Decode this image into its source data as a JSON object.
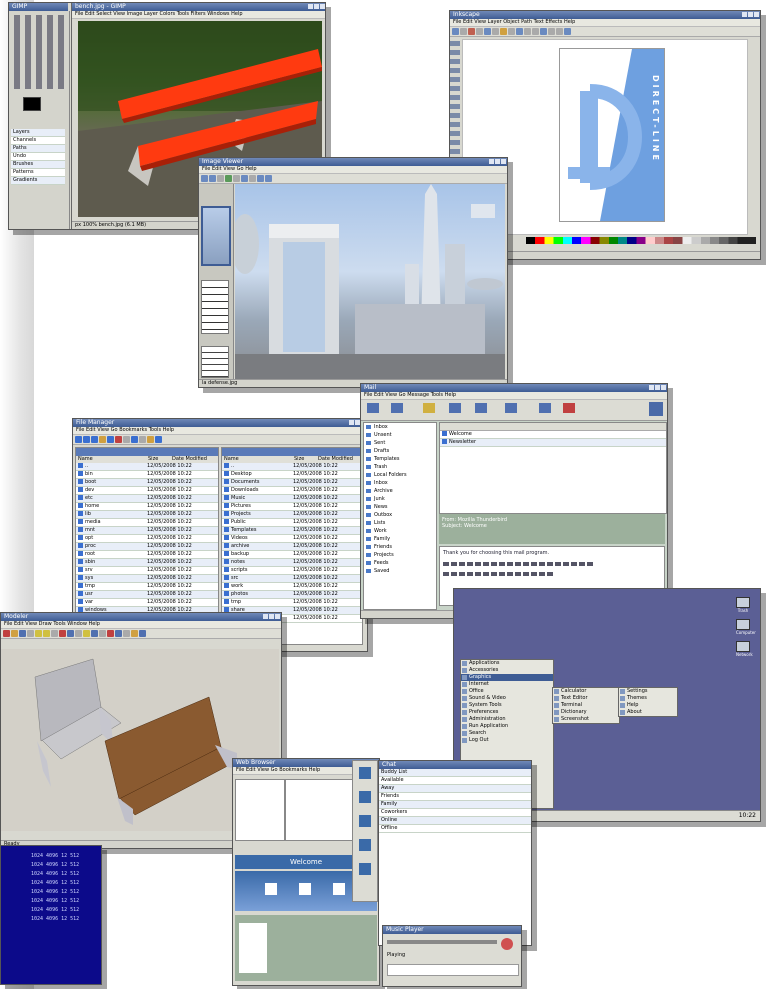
{
  "gimp": {
    "toolbox_title": "GIMP",
    "image_title": "bench.jpg - GIMP",
    "menu": "File  Edit  Select  View  Image  Layer  Colors  Tools  Filters  Windows  Help",
    "layer_panel": [
      "Layers",
      "Channels",
      "Paths",
      "Undo",
      "Brushes",
      "Patterns",
      "Gradients"
    ],
    "status": "px  100%  bench.jpg (6.1 MB)"
  },
  "inkscape": {
    "title": "Inkscape",
    "menu": "File  Edit  View  Layer  Object  Path  Text  Effects  Help",
    "logo_text": "DIRECT-LINE",
    "status": "Drawing"
  },
  "viewer": {
    "title": "Image Viewer",
    "menu": "File  Edit  View  Go  Help",
    "caption": "la defense.jpg"
  },
  "filemanager": {
    "title": "File Manager",
    "menu": "File  Edit  View  Go  Bookmarks  Tools  Help",
    "columns": [
      "Name",
      "Size",
      "Date Modified"
    ],
    "left_files": [
      "..",
      "bin",
      "boot",
      "dev",
      "etc",
      "home",
      "lib",
      "media",
      "mnt",
      "opt",
      "proc",
      "root",
      "sbin",
      "srv",
      "sys",
      "tmp",
      "usr",
      "var",
      "windows",
      "file.txt"
    ],
    "right_files": [
      "..",
      "Desktop",
      "Documents",
      "Downloads",
      "Music",
      "Pictures",
      "Projects",
      "Public",
      "Templates",
      "Videos",
      "archive",
      "backup",
      "notes",
      "scripts",
      "src",
      "work",
      "photos",
      "tmp",
      "share",
      "readme"
    ],
    "date_value": "12/05/2008 10:22"
  },
  "mail": {
    "title": "Mail",
    "menu": "File  Edit  View  Go  Message  Tools  Help",
    "toolbar": [
      "Get Mail",
      "Write",
      "Address Book",
      "Reply",
      "Reply All",
      "Forward",
      "Delete",
      "Print"
    ],
    "folders": [
      "Inbox",
      "Unsent",
      "Sent",
      "Drafts",
      "Templates",
      "Trash",
      "Local Folders",
      "Inbox",
      "Archive",
      "Junk",
      "News",
      "Outbox",
      "Lists",
      "Work",
      "Family",
      "Friends",
      "Projects",
      "Feeds",
      "Saved"
    ],
    "messages": [
      "Welcome",
      "Newsletter"
    ],
    "from": "From: Mozilla Thunderbird",
    "subject": "Subject: Welcome",
    "body": "Thank you for choosing this mail program."
  },
  "cad": {
    "title": "Modeler",
    "menu": "File  Edit  View  Draw  Tools  Window  Help",
    "status": "Ready"
  },
  "desktop": {
    "icons": [
      "Trash",
      "Computer",
      "Network"
    ],
    "menu": [
      "Applications",
      "Accessories",
      "Graphics",
      "Internet",
      "Office",
      "Sound & Video",
      "System Tools",
      "Preferences",
      "Administration",
      "Run Application",
      "Search",
      "Log Out"
    ],
    "submenu": [
      "Calculator",
      "Text Editor",
      "Terminal",
      "Dictionary",
      "Screenshot"
    ],
    "submenu2": [
      "Settings",
      "Themes",
      "Help",
      "About"
    ],
    "clock": "10:22"
  },
  "browser": {
    "title": "Web Browser",
    "menu": "File  Edit  View  Go  Bookmarks  Help",
    "banner": "Welcome",
    "panel_label": "Sidebar"
  },
  "chat": {
    "title": "Chat",
    "lines": [
      "Buddy List",
      "Available",
      "Away",
      "Friends",
      "Family",
      "Coworkers",
      "Online",
      "Offline"
    ]
  },
  "player": {
    "title": "Music Player",
    "track": "Playing"
  },
  "terminal": {
    "lines": [
      "1024 4096 12 512",
      "1024 4096 12 512",
      "1024 4096 12 512",
      "1024 4096 12 512",
      "1024 4096 12 512",
      "1024 4096 12 512",
      "1024 4096 12 512",
      "1024 4096 12 512"
    ]
  }
}
